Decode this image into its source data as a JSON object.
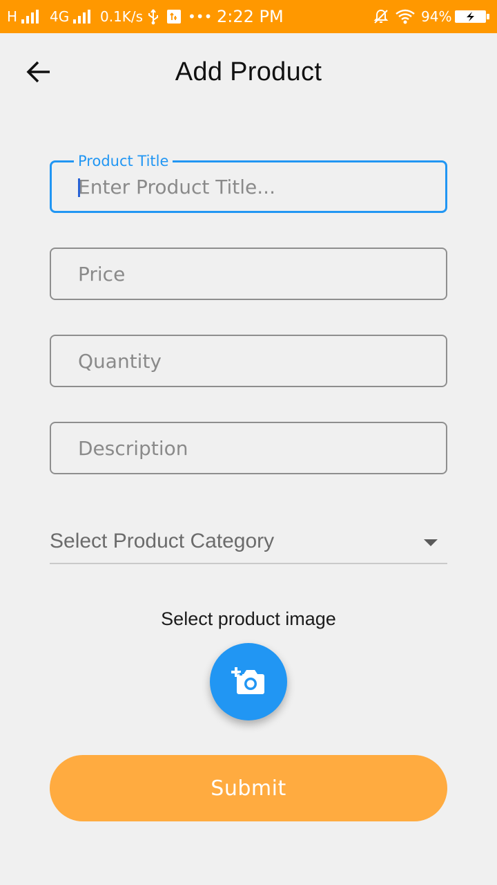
{
  "status_bar": {
    "network_type": "H",
    "network_generation": "4G",
    "data_speed": "0.1K/s",
    "overflow": "•••",
    "time": "2:22 PM",
    "battery_percent": "94%",
    "background_color": "#ff9800"
  },
  "header": {
    "back_icon": "arrow-left-icon",
    "title": "Add Product"
  },
  "form": {
    "product_title": {
      "label": "Product Title",
      "placeholder": "Enter Product Title...",
      "value": ""
    },
    "price": {
      "placeholder": "Price",
      "value": ""
    },
    "quantity": {
      "placeholder": "Quantity",
      "value": ""
    },
    "description": {
      "placeholder": "Description",
      "value": ""
    },
    "category": {
      "selected": "Select Product Category",
      "arrow_icon": "dropdown-arrow-icon"
    },
    "image": {
      "label": "Select product image",
      "icon": "add-a-photo-icon"
    },
    "submit_label": "Submit"
  },
  "colors": {
    "accent": "#2196f3",
    "submit": "#ffab40",
    "background": "#f0f0f0"
  }
}
